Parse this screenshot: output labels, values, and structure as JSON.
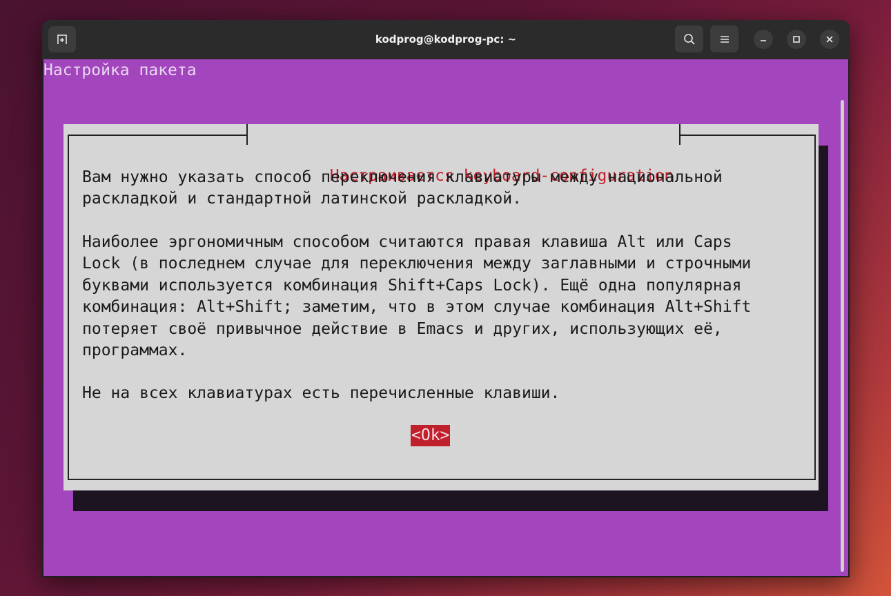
{
  "window": {
    "title": "kodprog@kodprog-pc: ~",
    "icons": {
      "new_tab": "new-tab-icon",
      "search": "search-icon",
      "menu": "hamburger-menu-icon",
      "minimize": "minimize-icon",
      "maximize": "maximize-icon",
      "close": "close-icon"
    }
  },
  "terminal": {
    "screen_title": "Настройка пакета",
    "dialog": {
      "title": "Настраивается keyboard-configuration",
      "paragraphs": [
        "Вам нужно указать способ переключения клавиатуры между национальной\nраскладкой и стандартной латинской раскладкой.",
        "Наиболее эргономичным способом считаются правая клавиша Alt или Caps\nLock (в последнем случае для переключения между заглавными и строчными\nбуквами используется комбинация Shift+Caps Lock). Ещё одна популярная\nкомбинация: Alt+Shift; заметим, что в этом случае комбинация Alt+Shift\nпотеряет своё привычное действие в Emacs и других, использующих её,\nпрограммах.",
        "Не на всех клавиатурах есть перечисленные клавиши."
      ],
      "ok_button": "<Ok>"
    }
  },
  "colors": {
    "terminal_bg": "#a346be",
    "dialog_bg": "#d6d6d6",
    "accent_red": "#c0202c",
    "titlebar_bg": "#2b2b2b"
  }
}
